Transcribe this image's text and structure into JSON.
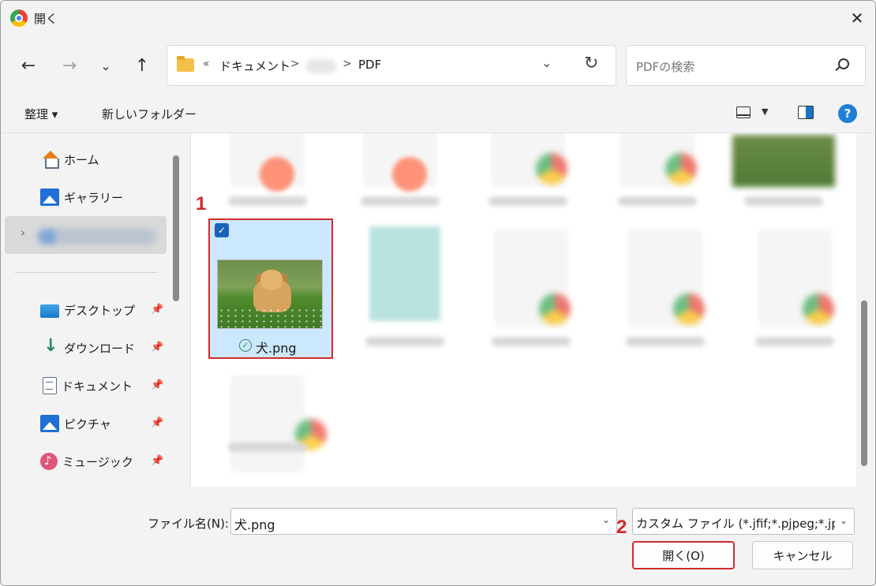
{
  "window": {
    "title": "開く"
  },
  "nav": {
    "breadcrumbs": [
      "«",
      "ドキュメント",
      ">",
      ">",
      "PDF"
    ],
    "search_placeholder": "PDFの検索"
  },
  "toolbar": {
    "organize": "整理 ▾",
    "new_folder": "新しいフォルダー",
    "help": "?"
  },
  "sidebar": {
    "items": [
      {
        "label": "ホーム",
        "icon": "home-icon"
      },
      {
        "label": "ギャラリー",
        "icon": "gallery-icon"
      },
      {
        "label": "デスクトップ",
        "icon": "desktop-icon",
        "pinned": true
      },
      {
        "label": "ダウンロード",
        "icon": "download-icon",
        "pinned": true
      },
      {
        "label": "ドキュメント",
        "icon": "document-icon",
        "pinned": true
      },
      {
        "label": "ピクチャ",
        "icon": "pictures-icon",
        "pinned": true
      },
      {
        "label": "ミュージック",
        "icon": "music-icon",
        "pinned": true
      }
    ]
  },
  "files": {
    "selected": {
      "name": "犬.png",
      "checked": true
    }
  },
  "annotations": {
    "step1": "1",
    "step2": "2",
    "accent_color": "#d12b2b"
  },
  "footer": {
    "filename_label": "ファイル名(N):",
    "filename_value": "犬.png",
    "filetype_value": "カスタム ファイル (*.jfif;*.pjpeg;*.jpeg;*.pjp;*.jpg;*.png)",
    "open_button": "開く(O)",
    "cancel_button": "キャンセル"
  }
}
